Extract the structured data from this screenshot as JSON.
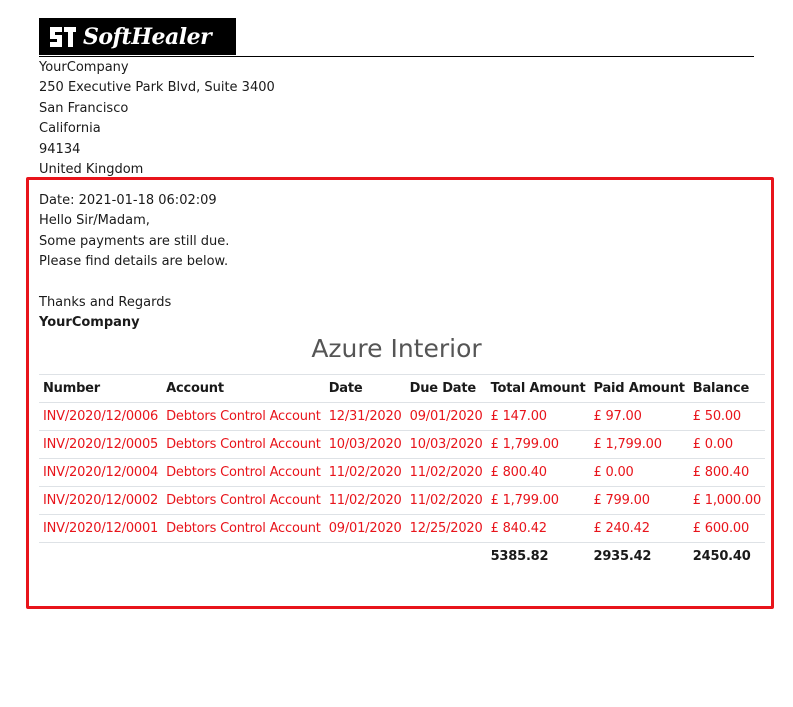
{
  "logo": {
    "text": "SoftHealer"
  },
  "company_address": {
    "name": "YourCompany",
    "street": "250 Executive Park Blvd, Suite 3400",
    "city": "San Francisco",
    "state": "California",
    "zip": "94134",
    "country": "United Kingdom"
  },
  "letter": {
    "date": "Date: 2021-01-18 06:02:09",
    "greeting": "Hello Sir/Madam,",
    "line1": "Some payments are still due.",
    "line2": "Please find details are below.",
    "closing": "Thanks and Regards",
    "signature": "YourCompany"
  },
  "partner_name": "Azure Interior",
  "table": {
    "headers": [
      "Number",
      "Account",
      "Date",
      "Due Date",
      "Total Amount",
      "Paid Amount",
      "Balance"
    ],
    "rows": [
      [
        "INV/2020/12/0006",
        "Debtors Control Account",
        "12/31/2020",
        "09/01/2020",
        "£ 147.00",
        "£ 97.00",
        "£ 50.00"
      ],
      [
        "INV/2020/12/0005",
        "Debtors Control Account",
        "10/03/2020",
        "10/03/2020",
        "£ 1,799.00",
        "£ 1,799.00",
        "£ 0.00"
      ],
      [
        "INV/2020/12/0004",
        "Debtors Control Account",
        "11/02/2020",
        "11/02/2020",
        "£ 800.40",
        "£ 0.00",
        "£ 800.40"
      ],
      [
        "INV/2020/12/0002",
        "Debtors Control Account",
        "11/02/2020",
        "11/02/2020",
        "£ 1,799.00",
        "£ 799.00",
        "£ 1,000.00"
      ],
      [
        "INV/2020/12/0001",
        "Debtors Control Account",
        "09/01/2020",
        "12/25/2020",
        "£ 840.42",
        "£ 240.42",
        "£ 600.00"
      ]
    ],
    "totals": {
      "total_amount": "5385.82",
      "paid_amount": "2935.42",
      "balance": "2450.40"
    }
  },
  "colors": {
    "due_text": "#e8141b",
    "highlight_border": "#e8141b",
    "logo_bg": "#000000"
  }
}
